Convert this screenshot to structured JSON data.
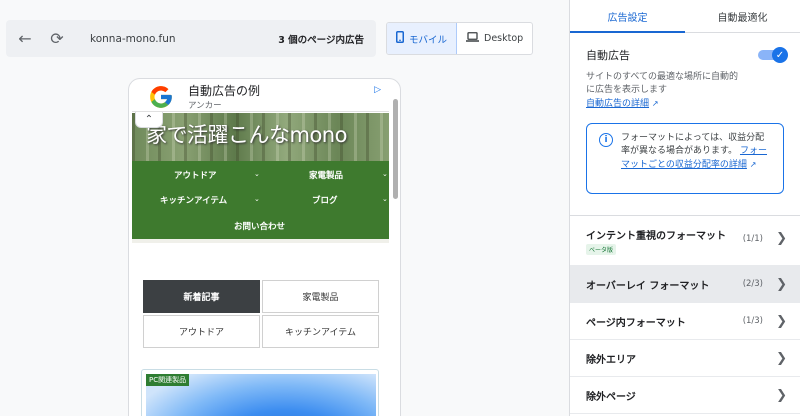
{
  "toolbar": {
    "url": "konna-mono.fun",
    "ad_count": "3 個のページ内広告"
  },
  "device_toggle": {
    "mobile_label": "モバイル",
    "desktop_label": "Desktop"
  },
  "preview": {
    "ad_banner": {
      "title": "自動広告の例",
      "subtitle": "アンカー"
    },
    "hero_title": "家で活躍こんなmono",
    "nav": [
      {
        "label": "アウトドア"
      },
      {
        "label": "家電製品"
      },
      {
        "label": "キッチンアイテム"
      },
      {
        "label": "ブログ"
      },
      {
        "label": "お問い合わせ"
      }
    ],
    "categories": [
      {
        "label": "新着記事"
      },
      {
        "label": "家電製品"
      },
      {
        "label": "アウトドア"
      },
      {
        "label": "キッチンアイテム"
      }
    ],
    "card_badge": "PC関連製品"
  },
  "panel": {
    "tabs": [
      {
        "label": "広告設定"
      },
      {
        "label": "自動最適化"
      }
    ],
    "auto_ads": {
      "title": "自動広告",
      "description": "サイトのすべての最適な場所に自動的に広告を表示します",
      "link": "自動広告の詳細"
    },
    "info": {
      "text": "フォーマットによっては、収益分配率が異なる場合があります。",
      "link": "フォーマットごとの収益分配率の詳細"
    },
    "rows": [
      {
        "label": "インテント重視のフォーマット",
        "badge": "ベータ版",
        "count": "(1/1)"
      },
      {
        "label": "オーバーレイ フォーマット",
        "count": "(2/3)"
      },
      {
        "label": "ページ内フォーマット",
        "count": "(1/3)"
      },
      {
        "label": "除外エリア"
      },
      {
        "label": "除外ページ"
      }
    ]
  },
  "colors": {
    "accent": "#1a73e8",
    "nav_green": "#3e7a2e"
  }
}
